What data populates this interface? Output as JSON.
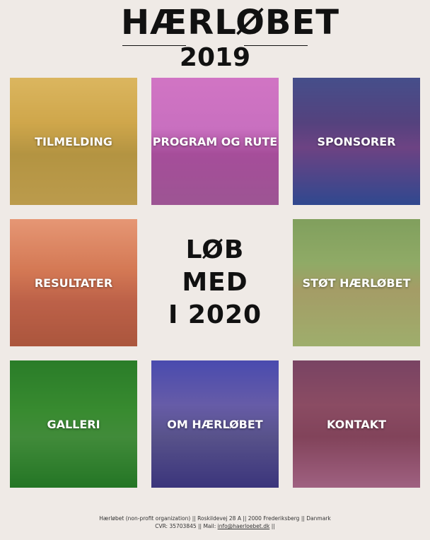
{
  "logo": {
    "title": "HÆRLØBET",
    "year": "2019"
  },
  "tiles": [
    {
      "label": "TILMELDING",
      "overlay": "rgba(214,170,60,0.55)",
      "photo": "linear-gradient(180deg,#e2c58a 0%,#c9a45e 35%,#8b7a4a 60%,#9c8a60 100%)"
    },
    {
      "label": "PROGRAM OG RUTE",
      "overlay": "rgba(200,60,170,0.45)",
      "photo": "linear-gradient(180deg,#d9a3d9 0%,#c99ad0 40%,#8a5c8c 60%,#7a6a80 100%)"
    },
    {
      "label": "SPONSORER",
      "overlay": "rgba(40,70,160,0.55)",
      "photo": "linear-gradient(180deg,#6a5a70 0%,#8a3f55 35%,#c04060 55%,#3a4d7a 100%)"
    },
    {
      "label": "RESULTATER",
      "overlay": "rgba(230,120,70,0.45)",
      "photo": "linear-gradient(180deg,#e5b09a 0%,#c57a60 40%,#9a4f4a 65%,#7a3a35 100%)"
    },
    {
      "label": "STØT HÆRLØBET",
      "overlay": "rgba(150,190,90,0.45)",
      "photo": "linear-gradient(180deg,#6f8660 0%,#8a9a70 35%,#b08070 55%,#a5a07a 100%)"
    },
    {
      "label": "GALLERI",
      "overlay": "rgba(30,140,40,0.55)",
      "photo": "linear-gradient(180deg,#3a6a2a 0%,#5a8a3a 40%,#6d8a50 60%,#2d5a22 100%)"
    },
    {
      "label": "OM HÆRLØBET",
      "overlay": "rgba(60,50,160,0.55)",
      "photo": "linear-gradient(180deg,#5a6ac0 0%,#9a90b0 35%,#7a7a70 60%,#3a3a50 100%)"
    },
    {
      "label": "KONTAKT",
      "overlay": "rgba(140,40,110,0.45)",
      "photo": "linear-gradient(180deg,#6a5a5a 0%,#8a6a5a 35%,#7a5a4a 60%,#b09090 100%)"
    }
  ],
  "center": {
    "line1": "LØB MED",
    "line2": "I 2020"
  },
  "footer": {
    "line1": "Hærløbet (non-profit organization) || Roskildevej 28 A || 2000 Frederiksberg || Danmark",
    "line2_prefix": "CVR: 35703845 || Mail: ",
    "email": "info@haerloebet.dk",
    "line2_suffix": " ||"
  }
}
